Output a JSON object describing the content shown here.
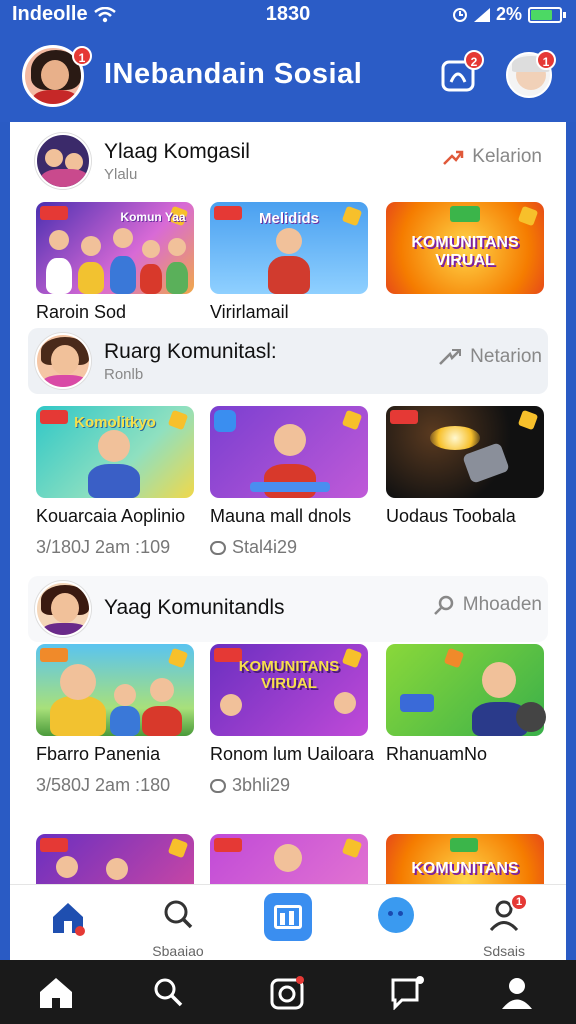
{
  "status_bar": {
    "carrier": "Indeolle",
    "time": "1830",
    "battery": "2%",
    "battery_level": 0.75
  },
  "header": {
    "title": "INebandain Sosial",
    "notif_badge": "1",
    "chat_badge": "2",
    "profile_badge": "1"
  },
  "sections": [
    {
      "title": "Ylaag Komgasil",
      "subtitle": "Ylalu",
      "action": "Kelarion",
      "cards": [
        {
          "title": "Raroin Sod",
          "thumb_text": "Komun Yaa"
        },
        {
          "title": "Virirlamail",
          "thumb_text": "Melidids"
        },
        {
          "title": "",
          "thumb_text": "KOMUNITANS VIRUAL"
        }
      ]
    },
    {
      "title": "Ruarg Komunitasl:",
      "subtitle": "Ronlb",
      "action": "Netarion",
      "cards": [
        {
          "title": "Kouarcaia Aoplinio",
          "meta": "3/180J 2am :109",
          "thumb_text": "Komolitkyo"
        },
        {
          "title": "Mauna mall dnols",
          "meta": "Stal4i29",
          "thumb_text": ""
        },
        {
          "title": "Uodaus Toobala",
          "meta": "",
          "thumb_text": ""
        }
      ]
    },
    {
      "title": "Yaag Komunitandls",
      "subtitle": "",
      "action": "Mhoaden",
      "cards": [
        {
          "title": "Fbarro Panenia",
          "meta": "3/580J 2am :180",
          "thumb_text": ""
        },
        {
          "title": "Ronom lum Uailoara",
          "meta": "3bhli29",
          "thumb_text": "KOMUNITANS VIRUAL"
        },
        {
          "title": "RhanuamNo",
          "meta": "",
          "thumb_text": ""
        }
      ]
    },
    {
      "title": "",
      "subtitle": "",
      "action": "",
      "cards": [
        {
          "title": "",
          "thumb_text": ""
        },
        {
          "title": "",
          "thumb_text": ""
        },
        {
          "title": "",
          "thumb_text": "KOMUNITANS"
        }
      ]
    }
  ],
  "bottom_nav": {
    "home_label": "",
    "search_label": "Sbaaiao",
    "center_label": "",
    "chat_label": "",
    "profile_label": "Sdsais",
    "profile_badge": "1"
  },
  "colors": {
    "brand": "#2b5cc6",
    "accent": "#e0593a",
    "badge": "#e53935"
  }
}
